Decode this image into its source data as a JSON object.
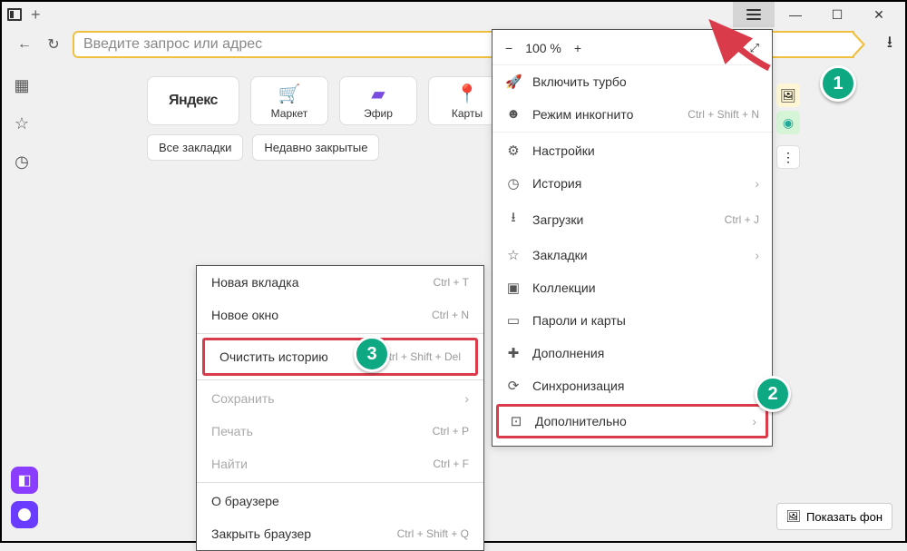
{
  "address_bar": {
    "placeholder": "Введите запрос или адрес"
  },
  "zoom": {
    "minus": "−",
    "value": "100 %",
    "plus": "+"
  },
  "tiles": {
    "yandex": "Яндекс",
    "market": "Маркет",
    "efir": "Эфир",
    "maps": "Карты"
  },
  "chips": {
    "all_bookmarks": "Все закладки",
    "recently_closed": "Недавно закрытые"
  },
  "menu": {
    "turbo": "Включить турбо",
    "incognito": "Режим инкогнито",
    "incognito_sc": "Ctrl + Shift + N",
    "settings": "Настройки",
    "history": "История",
    "downloads": "Загрузки",
    "downloads_sc": "Ctrl + J",
    "bookmarks": "Закладки",
    "collections": "Коллекции",
    "passwords": "Пароли и карты",
    "addons": "Дополнения",
    "sync": "Синхронизация",
    "more": "Дополнительно"
  },
  "submenu": {
    "new_tab": "Новая вкладка",
    "new_tab_sc": "Ctrl + T",
    "new_window": "Новое окно",
    "new_window_sc": "Ctrl + N",
    "clear_history": "Очистить историю",
    "clear_history_sc": "Ctrl + Shift + Del",
    "save": "Сохранить",
    "print": "Печать",
    "print_sc": "Ctrl + P",
    "find": "Найти",
    "find_sc": "Ctrl + F",
    "about": "О браузере",
    "close": "Закрыть браузер",
    "close_sc": "Ctrl + Shift + Q"
  },
  "show_bg": "Показать фон",
  "callouts": {
    "one": "1",
    "two": "2",
    "three": "3"
  }
}
